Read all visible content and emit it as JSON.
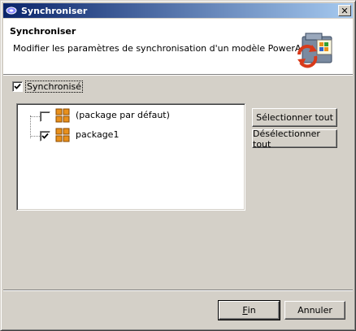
{
  "window": {
    "title": "Synchroniser",
    "close_glyph": "✕"
  },
  "header": {
    "title": "Synchroniser",
    "description": "Modifier les paramètres de synchronisation d'un modèle PowerAMC"
  },
  "sync_checkbox": {
    "label": "Synchronisé",
    "checked": true
  },
  "tree": {
    "items": [
      {
        "label": "(package par défaut)",
        "checked": false,
        "icon": "package-icon"
      },
      {
        "label": "package1",
        "checked": true,
        "icon": "package-icon"
      }
    ]
  },
  "side_buttons": {
    "select_all": "Sélectionner tout",
    "deselect_all": "Désélectionner tout"
  },
  "footer": {
    "finish_mnemonic": "F",
    "finish_rest": "in",
    "cancel": "Annuler"
  },
  "colors": {
    "title_start": "#0a246a",
    "title_end": "#a6caf0",
    "face": "#d4d0c8",
    "package_orange": "#e8901c"
  }
}
